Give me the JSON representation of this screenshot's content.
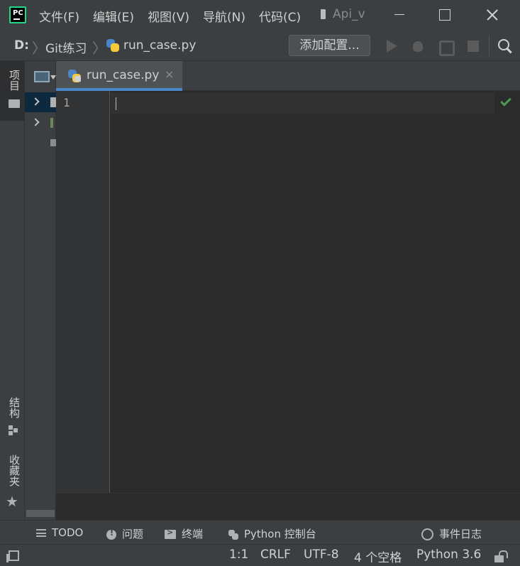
{
  "menu": [
    "文件(F)",
    "编辑(E)",
    "视图(V)",
    "导航(N)",
    "代码(C)"
  ],
  "app_logo_text": "PC",
  "window_title": "Api_v",
  "breadcrumb": {
    "drive": "D:",
    "folder": "Git练习",
    "file": "run_case.py"
  },
  "toolbar": {
    "add_config_label": "添加配置..."
  },
  "left_strip": {
    "project_label": "项目",
    "structure_label": "结构",
    "favorites_label": "收藏夹"
  },
  "editor": {
    "tab_label": "run_case.py",
    "tab_close": "×",
    "line_number": "1",
    "inspection_status": "ok"
  },
  "tool_windows": [
    "TODO",
    "问题",
    "终端",
    "Python 控制台",
    "事件日志"
  ],
  "status": {
    "position": "1:1",
    "line_separator": "CRLF",
    "encoding": "UTF-8",
    "indent": "4 个空格",
    "interpreter": "Python 3.6"
  },
  "colors": {
    "accent_blue": "#4a88c7",
    "check_green": "#499c54",
    "panel_bg": "#3c3f41",
    "editor_bg": "#2b2b2b"
  }
}
